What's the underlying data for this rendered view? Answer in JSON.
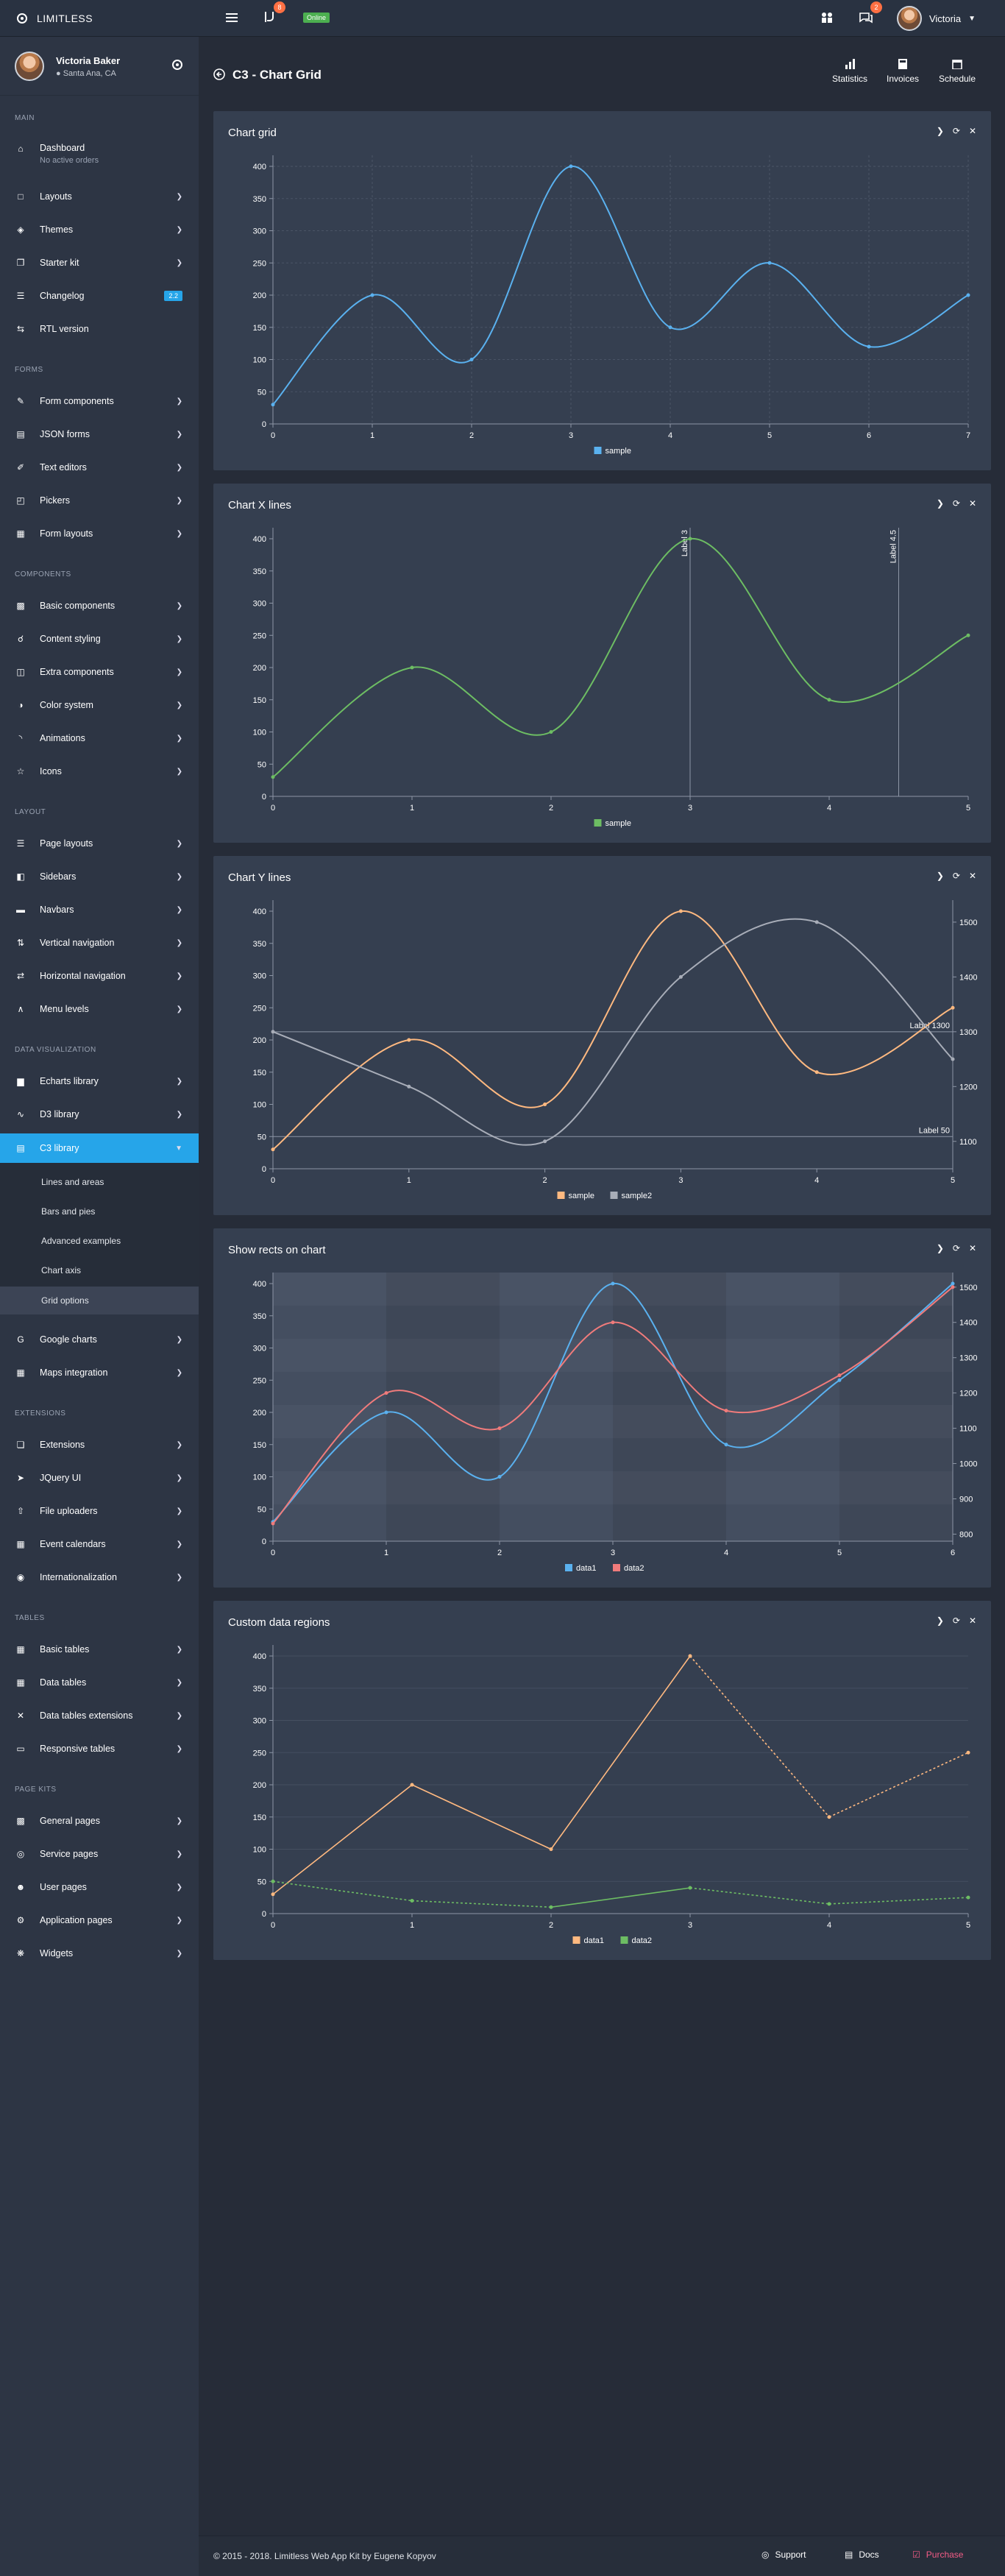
{
  "brand": {
    "name": "LIMITLESS"
  },
  "topbar": {
    "notif_count": "8",
    "status": "Online",
    "msg_count": "2",
    "user_name": "Victoria"
  },
  "sidebar_user": {
    "name": "Victoria Baker",
    "location": "Santa Ana, CA"
  },
  "sidebar": {
    "main_label": "MAIN",
    "dashboard": "Dashboard",
    "dashboard_sub": "No active orders",
    "layouts": "Layouts",
    "themes": "Themes",
    "starter": "Starter kit",
    "changelog": "Changelog",
    "changelog_ver": "2.2",
    "rtl": "RTL version",
    "forms_label": "FORMS",
    "form_components": "Form components",
    "json_forms": "JSON forms",
    "text_editors": "Text editors",
    "pickers": "Pickers",
    "form_layouts": "Form layouts",
    "components_label": "COMPONENTS",
    "basic_components": "Basic components",
    "content_styling": "Content styling",
    "extra_components": "Extra components",
    "color_system": "Color system",
    "animations": "Animations",
    "icons": "Icons",
    "layout_label": "LAYOUT",
    "page_layouts": "Page layouts",
    "sidebars": "Sidebars",
    "navbars": "Navbars",
    "vertical_nav": "Vertical navigation",
    "horizontal_nav": "Horizontal navigation",
    "menu_levels": "Menu levels",
    "dataviz_label": "DATA VISUALIZATION",
    "echarts": "Echarts library",
    "d3": "D3 library",
    "c3": "C3 library",
    "c3_sub": [
      "Lines and areas",
      "Bars and pies",
      "Advanced examples",
      "Chart axis",
      "Grid options"
    ],
    "google_charts": "Google charts",
    "maps": "Maps integration",
    "extensions_label": "EXTENSIONS",
    "extensions": "Extensions",
    "jquery_ui": "JQuery UI",
    "file_uploaders": "File uploaders",
    "event_calendars": "Event calendars",
    "i18n": "Internationalization",
    "tables_label": "TABLES",
    "basic_tables": "Basic tables",
    "data_tables": "Data tables",
    "dt_ext": "Data tables extensions",
    "responsive_tables": "Responsive tables",
    "pagekits_label": "PAGE KITS",
    "general_pages": "General pages",
    "service_pages": "Service pages",
    "user_pages": "User pages",
    "app_pages": "Application pages",
    "widgets": "Widgets"
  },
  "header": {
    "title": "C3 - Chart Grid",
    "stats": "Statistics",
    "invoices": "Invoices",
    "schedule": "Schedule"
  },
  "colors": {
    "blue": "#5ab1ef",
    "green": "#6dbd63",
    "orange": "#ffb980",
    "gray": "#a8adb8",
    "red": "#f07b7b",
    "active": "#26a5e9"
  },
  "chart_data": [
    {
      "type": "line",
      "title": "Chart grid",
      "x": [
        0,
        1,
        2,
        3,
        4,
        5,
        6,
        7
      ],
      "series": [
        {
          "name": "sample",
          "values": [
            30,
            200,
            100,
            400,
            150,
            250,
            120,
            200
          ]
        }
      ],
      "ylim": [
        0,
        400
      ],
      "yticks": [
        0,
        50,
        100,
        150,
        200,
        250,
        300,
        350,
        400
      ],
      "grid": "x and y",
      "legend": "bottom"
    },
    {
      "type": "line",
      "title": "Chart X lines",
      "x": [
        0,
        1,
        2,
        3,
        4,
        5
      ],
      "series": [
        {
          "name": "sample",
          "values": [
            30,
            200,
            100,
            400,
            150,
            250
          ]
        }
      ],
      "ylim": [
        0,
        400
      ],
      "yticks": [
        0,
        50,
        100,
        150,
        200,
        250,
        300,
        350,
        400
      ],
      "xlines": [
        {
          "x": 3,
          "label": "Label 3"
        },
        {
          "x": 4.5,
          "label": "Label 4.5"
        }
      ],
      "legend": "bottom"
    },
    {
      "type": "line",
      "title": "Chart Y lines",
      "x": [
        0,
        1,
        2,
        3,
        4,
        5
      ],
      "series": [
        {
          "name": "sample",
          "values": [
            30,
            200,
            100,
            400,
            150,
            250
          ],
          "axis": "y"
        },
        {
          "name": "sample2",
          "values": [
            1300,
            1200,
            1100,
            1400,
            1500,
            1250
          ],
          "axis": "y2"
        }
      ],
      "ylim": [
        0,
        400
      ],
      "y2lim": [
        1050,
        1520
      ],
      "yticks": [
        0,
        50,
        100,
        150,
        200,
        250,
        300,
        350,
        400
      ],
      "y2ticks": [
        1100,
        1200,
        1300,
        1400,
        1500
      ],
      "ylines": [
        {
          "y": 50,
          "label": "Label 50",
          "axis": "y"
        },
        {
          "y": 1300,
          "label": "Label 1300",
          "axis": "y2"
        }
      ],
      "legend": "bottom"
    },
    {
      "type": "line",
      "title": "Show rects on chart",
      "x": [
        0,
        1,
        2,
        3,
        4,
        5,
        6
      ],
      "series": [
        {
          "name": "data1",
          "values": [
            30,
            200,
            100,
            400,
            150,
            250,
            400
          ],
          "axis": "y"
        },
        {
          "name": "data2",
          "values": [
            830,
            1200,
            1100,
            1400,
            1150,
            1250,
            1500
          ],
          "axis": "y2"
        }
      ],
      "ylim": [
        0,
        400
      ],
      "y2lim": [
        780,
        1510
      ],
      "yticks": [
        0,
        50,
        100,
        150,
        200,
        250,
        300,
        350,
        400
      ],
      "y2ticks": [
        800,
        900,
        1000,
        1100,
        1200,
        1300,
        1400,
        1500
      ],
      "legend": "bottom"
    },
    {
      "type": "line",
      "title": "Custom data regions",
      "x": [
        0,
        1,
        2,
        3,
        4,
        5
      ],
      "series": [
        {
          "name": "data1",
          "values": [
            30,
            200,
            100,
            400,
            150,
            250
          ]
        },
        {
          "name": "data2",
          "values": [
            50,
            20,
            10,
            40,
            15,
            25
          ]
        }
      ],
      "ylim": [
        0,
        400
      ],
      "yticks": [
        0,
        50,
        100,
        150,
        200,
        250,
        300,
        350,
        400
      ],
      "legend": "bottom"
    }
  ],
  "footer": {
    "copyright": "© 2015 - 2018. Limitless Web App Kit by Eugene Kopyov",
    "support": "Support",
    "docs": "Docs",
    "purchase": "Purchase"
  }
}
